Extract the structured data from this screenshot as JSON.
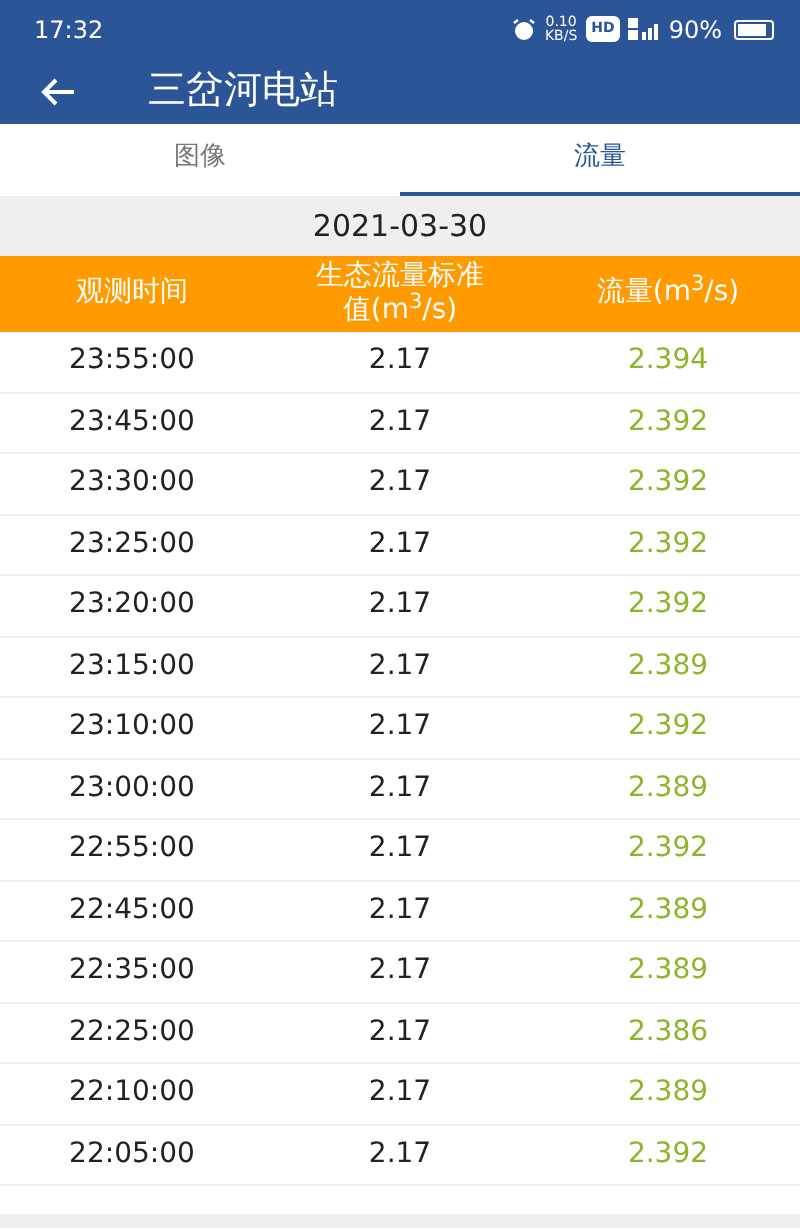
{
  "status_bar": {
    "time": "17:32",
    "net_speed": "0.10",
    "net_unit": "KB/S",
    "hd": "HD",
    "battery_text": "90%"
  },
  "header": {
    "title": "三岔河电站"
  },
  "tabs": [
    {
      "label": "图像",
      "selected": false
    },
    {
      "label": "流量",
      "selected": true
    }
  ],
  "date": "2021-03-30",
  "table": {
    "columns": [
      "观测时间",
      "生态流量标准值(m$^{3}$/s)",
      "流量(m$^{3}$/s)"
    ],
    "rows": [
      [
        "23:55:00",
        "2.17",
        "2.394"
      ],
      [
        "23:45:00",
        "2.17",
        "2.392"
      ],
      [
        "23:30:00",
        "2.17",
        "2.392"
      ],
      [
        "23:25:00",
        "2.17",
        "2.392"
      ],
      [
        "23:20:00",
        "2.17",
        "2.392"
      ],
      [
        "23:15:00",
        "2.17",
        "2.389"
      ],
      [
        "23:10:00",
        "2.17",
        "2.392"
      ],
      [
        "23:00:00",
        "2.17",
        "2.389"
      ],
      [
        "22:55:00",
        "2.17",
        "2.392"
      ],
      [
        "22:45:00",
        "2.17",
        "2.389"
      ],
      [
        "22:35:00",
        "2.17",
        "2.389"
      ],
      [
        "22:25:00",
        "2.17",
        "2.386"
      ],
      [
        "22:10:00",
        "2.17",
        "2.389"
      ],
      [
        "22:05:00",
        "2.17",
        "2.392"
      ]
    ]
  }
}
